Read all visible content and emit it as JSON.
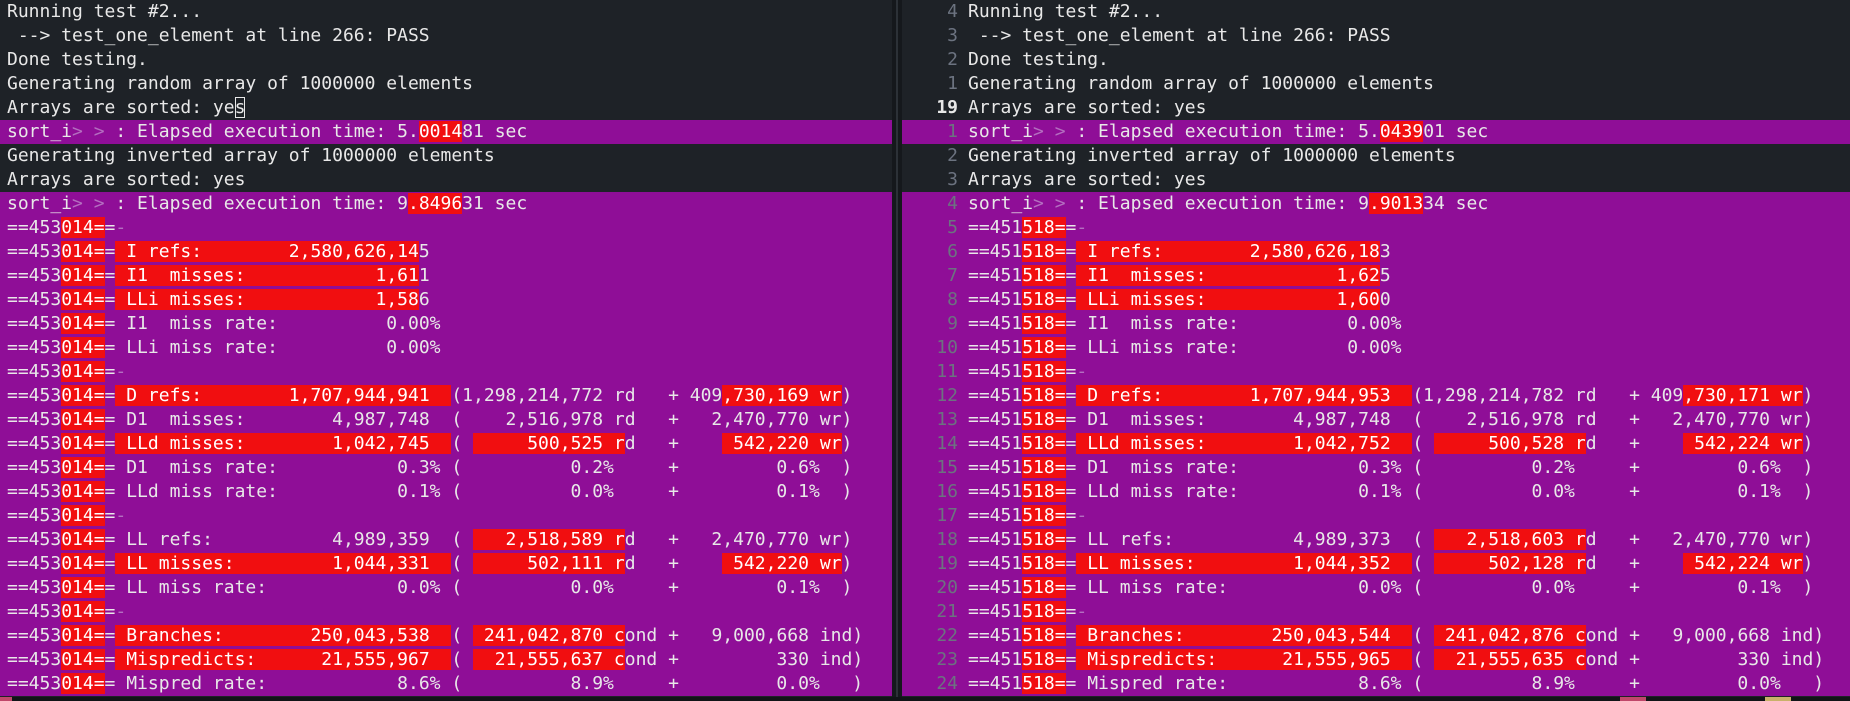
{
  "left": {
    "lines": [
      {
        "text": "Running test #2..."
      },
      {
        "text": " --> test_one_element at line 266: PASS"
      },
      {
        "text": "Done testing."
      },
      {
        "text": "Generating random array of 1000000 elements"
      },
      {
        "text": "Arrays are sorted: yes"
      },
      {
        "text": "sort_i> > : Elapsed execution time: 5.001481 sec"
      },
      {
        "text": "Generating inverted array of 1000000 elements"
      },
      {
        "text": "Arrays are sorted: yes"
      },
      {
        "text": "sort_i> > : Elapsed execution time: 9.849631 sec"
      },
      {
        "text": "==453014=="
      },
      {
        "text": "==453014== I refs:        2,580,626,145"
      },
      {
        "text": "==453014== I1  misses:            1,611"
      },
      {
        "text": "==453014== LLi misses:            1,586"
      },
      {
        "text": "==453014== I1  miss rate:          0.00%"
      },
      {
        "text": "==453014== LLi miss rate:          0.00%"
      },
      {
        "text": "==453014=="
      },
      {
        "text": "==453014== D refs:        1,707,944,941  (1,298,214,772 rd   + 409,730,169 wr)"
      },
      {
        "text": "==453014== D1  misses:        4,987,748  (    2,516,978 rd   +   2,470,770 wr)"
      },
      {
        "text": "==453014== LLd misses:        1,042,745  (      500,525 rd   +     542,220 wr)"
      },
      {
        "text": "==453014== D1  miss rate:           0.3% (          0.2%     +         0.6%  )"
      },
      {
        "text": "==453014== LLd miss rate:           0.1% (          0.0%     +         0.1%  )"
      },
      {
        "text": "==453014=="
      },
      {
        "text": "==453014== LL refs:           4,989,359  (    2,518,589 rd   +   2,470,770 wr)"
      },
      {
        "text": "==453014== LL misses:         1,044,331  (      502,111 rd   +     542,220 wr)"
      },
      {
        "text": "==453014== LL miss rate:            0.0% (          0.0%     +         0.1%  )"
      },
      {
        "text": "==453014=="
      },
      {
        "text": "==453014== Branches:        250,043,538  (  241,042,870 cond +   9,000,668 ind)"
      },
      {
        "text": "==453014== Mispredicts:      21,555,967  (   21,555,637 cond +         330 ind)"
      },
      {
        "text": "==453014== Mispred rate:            8.6% (          8.9%     +         0.0%   )"
      }
    ]
  },
  "right": {
    "lines": [
      {
        "num": "4",
        "text": "Running test #2..."
      },
      {
        "num": "3",
        "text": " --> test_one_element at line 266: PASS"
      },
      {
        "num": "2",
        "text": "Done testing."
      },
      {
        "num": "1",
        "text": "Generating random array of 1000000 elements"
      },
      {
        "num": "19",
        "text": "Arrays are sorted: yes"
      },
      {
        "num": "1",
        "text": "sort_i> > : Elapsed execution time: 5.043901 sec"
      },
      {
        "num": "2",
        "text": "Generating inverted array of 1000000 elements"
      },
      {
        "num": "3",
        "text": "Arrays are sorted: yes"
      },
      {
        "num": "4",
        "text": "sort_i> > : Elapsed execution time: 9.901334 sec"
      },
      {
        "num": "5",
        "text": "==451518=="
      },
      {
        "num": "6",
        "text": "==451518== I refs:        2,580,626,183"
      },
      {
        "num": "7",
        "text": "==451518== I1  misses:            1,625"
      },
      {
        "num": "8",
        "text": "==451518== LLi misses:            1,600"
      },
      {
        "num": "9",
        "text": "==451518== I1  miss rate:          0.00%"
      },
      {
        "num": "10",
        "text": "==451518== LLi miss rate:          0.00%"
      },
      {
        "num": "11",
        "text": "==451518=="
      },
      {
        "num": "12",
        "text": "==451518== D refs:        1,707,944,953  (1,298,214,782 rd   + 409,730,171 wr)"
      },
      {
        "num": "13",
        "text": "==451518== D1  misses:        4,987,748  (    2,516,978 rd   +   2,470,770 wr)"
      },
      {
        "num": "14",
        "text": "==451518== LLd misses:        1,042,752  (      500,528 rd   +     542,224 wr)"
      },
      {
        "num": "15",
        "text": "==451518== D1  miss rate:           0.3% (          0.2%     +         0.6%  )"
      },
      {
        "num": "16",
        "text": "==451518== LLd miss rate:           0.1% (          0.0%     +         0.1%  )"
      },
      {
        "num": "17",
        "text": "==451518=="
      },
      {
        "num": "18",
        "text": "==451518== LL refs:           4,989,373  (    2,518,603 rd   +   2,470,770 wr)"
      },
      {
        "num": "19",
        "text": "==451518== LL misses:         1,044,352  (      502,128 rd   +     542,224 wr)"
      },
      {
        "num": "20",
        "text": "==451518== LL miss rate:            0.0% (          0.0%     +         0.1%  )"
      },
      {
        "num": "21",
        "text": "==451518=="
      },
      {
        "num": "22",
        "text": "==451518== Branches:        250,043,544  (  241,042,876 cond +   9,000,668 ind)"
      },
      {
        "num": "23",
        "text": "==451518== Mispredicts:      21,555,965  (   21,555,635 cond +         330 ind)"
      },
      {
        "num": "24",
        "text": "==451518== Mispred rate:            8.6% (          8.9%     +         0.0%   )"
      }
    ]
  },
  "colors": {
    "background": "#1e2227",
    "diff_line": "#8f0e97",
    "diff_change": "#f10e10",
    "line_number": "#6c7380",
    "text": "#e8e8e8"
  }
}
